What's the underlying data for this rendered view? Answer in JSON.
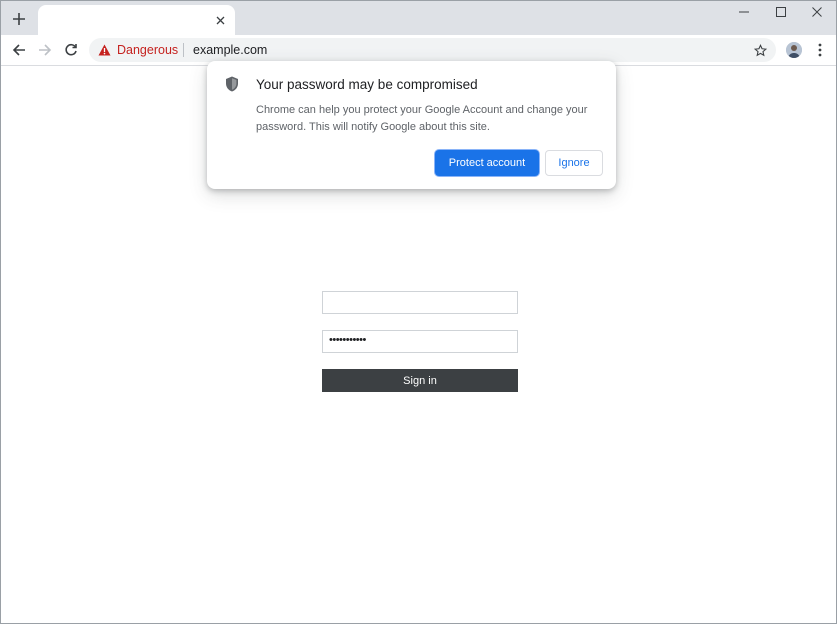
{
  "browser": {
    "tab": {
      "title": "",
      "close_icon": "close-icon"
    },
    "new_tab_icon": "plus-icon",
    "window_controls": [
      "minimize-icon",
      "maximize-icon",
      "close-icon"
    ],
    "toolbar": {
      "back_icon": "arrow-left-icon",
      "forward_icon": "arrow-right-icon",
      "reload_icon": "reload-icon",
      "security_label": "Dangerous",
      "url": "example.com",
      "bookmark_icon": "star-icon",
      "menu_icon": "kebab-menu-icon"
    }
  },
  "bubble": {
    "icon": "shield-icon",
    "title": "Your password may be compromised",
    "body": "Chrome can help you protect your Google Account and change your password. This will notify Google about this site.",
    "primary_button": "Protect account",
    "secondary_button": "Ignore"
  },
  "login_form": {
    "username_value": "",
    "password_value": "•••••••••••",
    "submit_label": "Sign in"
  },
  "colors": {
    "accent": "#1a73e8",
    "danger": "#c5221f",
    "tabstrip": "#dee1e6",
    "signin_button": "#3c4043"
  }
}
